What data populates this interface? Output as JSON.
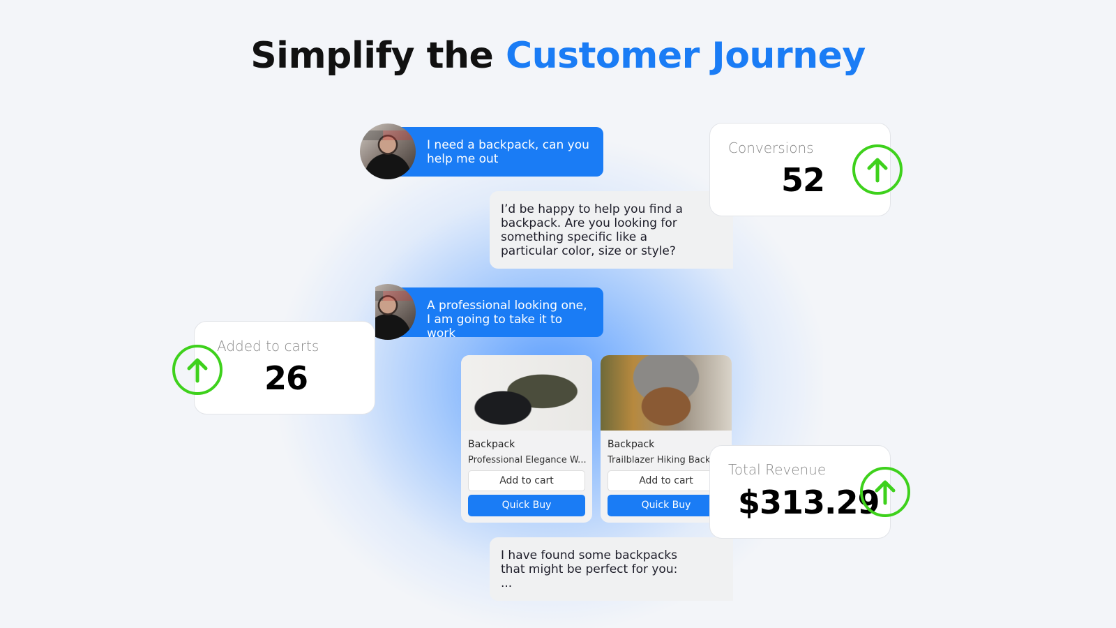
{
  "title": {
    "prefix": "Simplify the",
    "accent": "Customer Journey"
  },
  "colors": {
    "accent": "#1a7cf5",
    "success": "#3ed11c",
    "bot_bubble": "#f0f1f2"
  },
  "chat": [
    {
      "role": "user",
      "line1": "I need a backpack, can you",
      "line2": "help me out"
    },
    {
      "role": "bot",
      "lines": [
        "I’d be happy to help you find a",
        "backpack. Are you looking for",
        "something specific like a",
        "particular color, size or style?"
      ]
    },
    {
      "role": "user",
      "line1": "A professional looking one,",
      "line2": "I am going to take it to work"
    },
    {
      "role": "bot",
      "lines": [
        "I have found some backpacks",
        "that might be perfect for you:",
        "..."
      ]
    }
  ],
  "products": [
    {
      "title": "Backpack",
      "description": "Professional Elegance W...",
      "add_label": "Add to cart",
      "buy_label": "Quick Buy"
    },
    {
      "title": "Backpack",
      "description": "Trailblazer Hiking Backpack",
      "add_label": "Add to cart",
      "buy_label": "Quick Buy"
    }
  ],
  "metrics": {
    "conversions": {
      "label": "Conversions",
      "value": "52",
      "trend": "up"
    },
    "added_to_carts": {
      "label": "Added to carts",
      "value": "26",
      "trend": "up"
    },
    "total_revenue": {
      "label": "Total Revenue",
      "value": "$313.29",
      "trend": "up"
    }
  }
}
